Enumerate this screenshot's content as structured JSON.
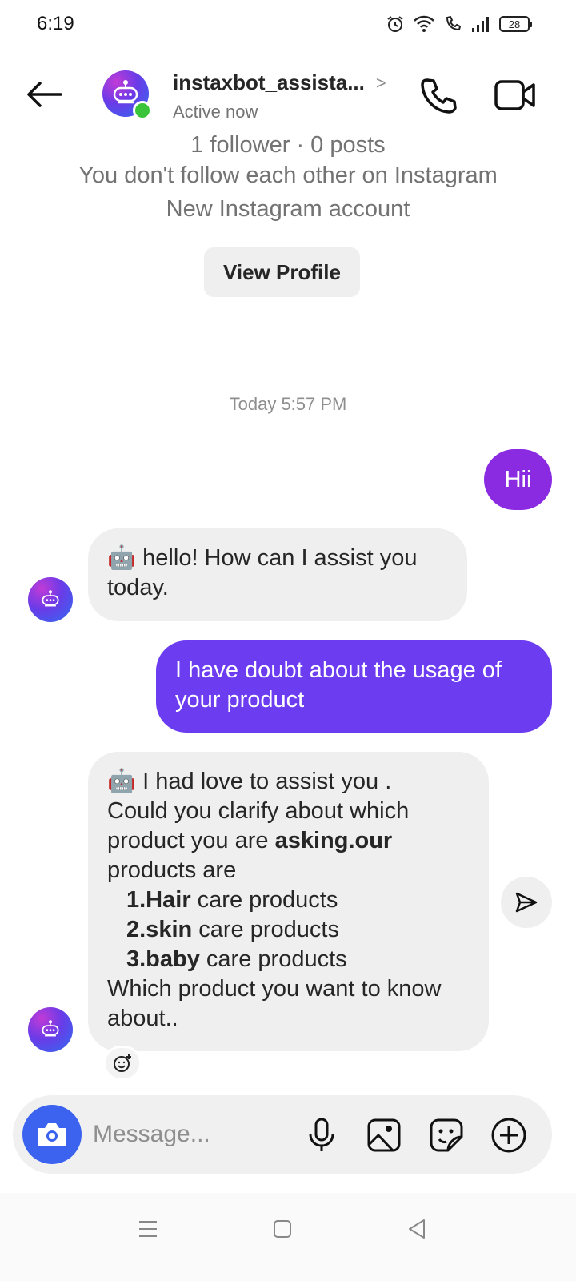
{
  "status_bar": {
    "time": "6:19",
    "battery": "28"
  },
  "header": {
    "contact_name": "instaxbot_assista...",
    "active_status": "Active now"
  },
  "profile_info": {
    "followers": "1 follower · 0 posts",
    "relationship": "You don't follow each other on Instagram",
    "account_note": "New Instagram account",
    "view_profile_label": "View Profile"
  },
  "timestamp": "Today 5:57 PM",
  "messages": {
    "sent_1": "Hii",
    "received_1_prefix": "🤖",
    "received_1": "hello! How can I assist you today.",
    "sent_2": "I have doubt about the usage of your product",
    "received_2": {
      "prefix": "🤖",
      "line1": "I had love to assist you .",
      "line2": "Could you clarify about which",
      "line3_pre": "product you are ",
      "line3_bold": "asking.our",
      "line4": "products are",
      "item1_bold": "1.Hair",
      "item1_rest": " care products",
      "item2_bold": "2.skin",
      "item2_rest": " care products",
      "item3_bold": "3.baby",
      "item3_rest": " care products",
      "line_end1": "Which product you want to know",
      "line_end2": "about.."
    }
  },
  "composer": {
    "placeholder": "Message..."
  },
  "colors": {
    "sent_bubble_1": "#8a2be2",
    "sent_bubble_2": "#6c3cf0",
    "received_bubble": "#efefef",
    "camera_button": "#3c63ef",
    "online_dot": "#3ac43a"
  },
  "icons": [
    "back-arrow-icon",
    "chevron-right-icon",
    "phone-icon",
    "video-icon",
    "robot-icon",
    "send-icon",
    "add-reaction-icon",
    "camera-icon",
    "mic-icon",
    "gallery-icon",
    "sticker-icon",
    "plus-circle-icon",
    "menu-icon",
    "home-square-icon",
    "back-triangle-icon"
  ]
}
